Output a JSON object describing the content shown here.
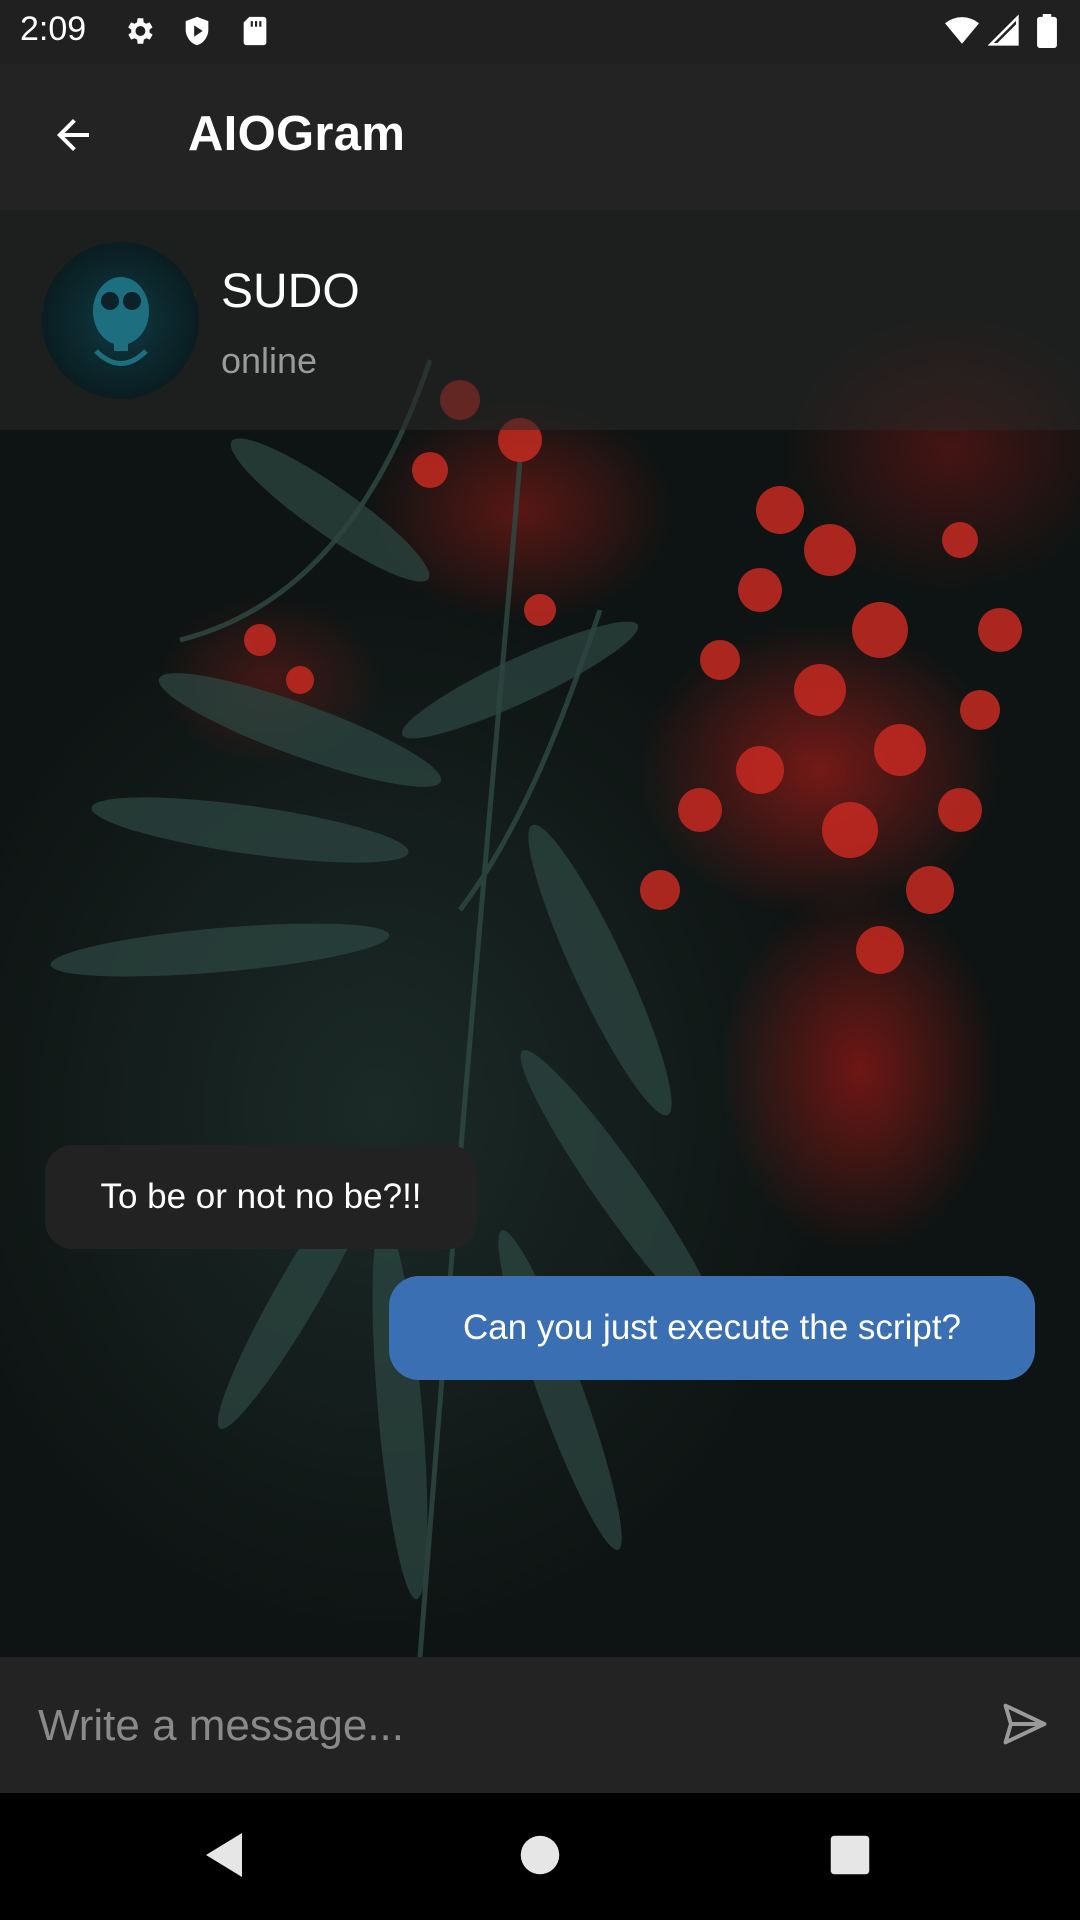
{
  "status_bar": {
    "time": "2:09",
    "icons": [
      "settings-icon",
      "shield-play-icon",
      "sd-card-icon",
      "wifi-icon",
      "signal-icon",
      "battery-icon"
    ]
  },
  "app_bar": {
    "title": "AIOGram",
    "back_icon": "arrow-left-icon"
  },
  "contact": {
    "name": "SUDO",
    "status": "online"
  },
  "messages": [
    {
      "direction": "incoming",
      "text": "To be or not no be?!!"
    },
    {
      "direction": "outgoing",
      "text": "Can you just execute the script?"
    }
  ],
  "composer": {
    "placeholder": "Write a message...",
    "value": "",
    "send_icon": "send-icon"
  },
  "nav_bar": {
    "icons": [
      "nav-back-icon",
      "nav-home-icon",
      "nav-recents-icon"
    ]
  },
  "colors": {
    "outgoing_bubble": "#3b6fb3",
    "incoming_bubble": "#222222",
    "app_bar": "#232323"
  }
}
